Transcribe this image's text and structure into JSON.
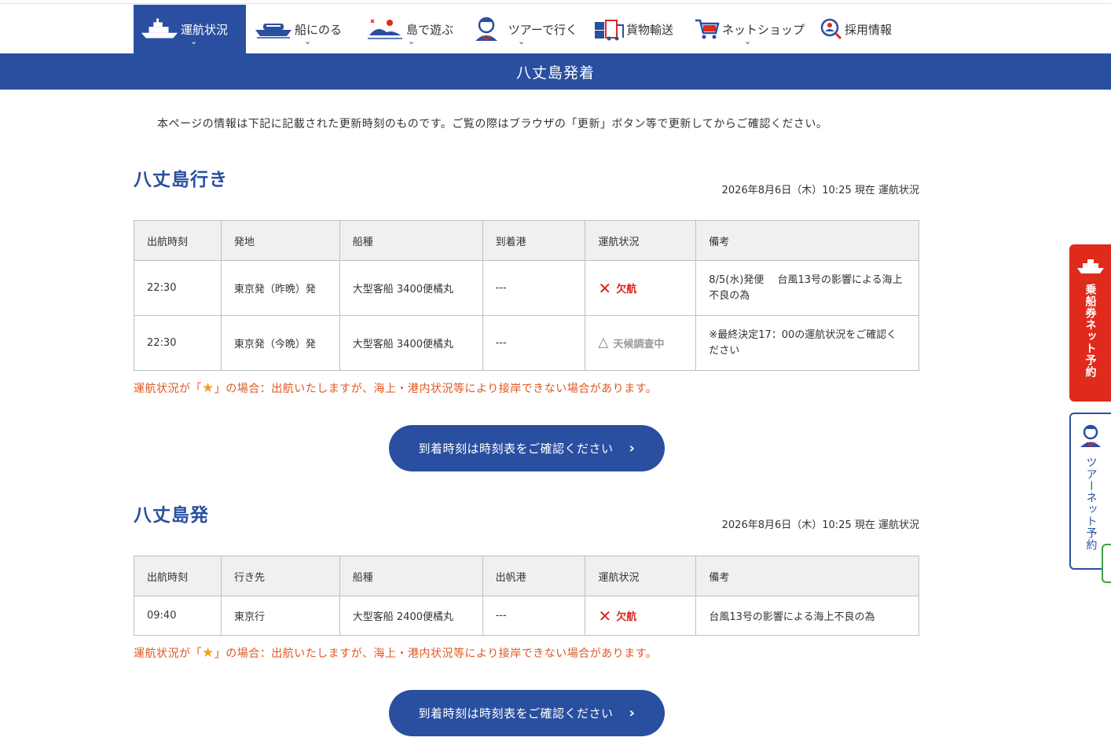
{
  "nav": {
    "items": [
      {
        "label": "運航状況",
        "icon": "ship-icon",
        "active": true
      },
      {
        "label": "船にのる",
        "icon": "ferry-icon"
      },
      {
        "label": "島で遊ぶ",
        "icon": "island-icon"
      },
      {
        "label": "ツアーで行く",
        "icon": "guide-icon"
      },
      {
        "label": "貨物輸送",
        "icon": "cargo-icon"
      },
      {
        "label": "ネットショップ",
        "icon": "cart-icon"
      },
      {
        "label": "採用情報",
        "icon": "recruit-icon"
      }
    ]
  },
  "banner": {
    "title": "八丈島発着"
  },
  "notice": "本ページの情報は下記に記載された更新時刻のものです。ご覧の際はブラウザの「更新」ボタン等で更新してからご確認ください。",
  "sections": [
    {
      "title": "八丈島行き",
      "asof": "2026年8月6日（木）10:25 現在 運航状況",
      "headers": [
        "出航時刻",
        "発地",
        "船種",
        "到着港",
        "運航状況",
        "備考"
      ],
      "rows": [
        {
          "time": "22:30",
          "place": "東京発（昨晩）発",
          "ship": "大型客船 3400便橘丸",
          "port": "---",
          "status": "欠航",
          "status_type": "cancel",
          "remarks": "8/5(水)発便　 台風13号の影響による海上不良の為"
        },
        {
          "time": "22:30",
          "place": "東京発（今晩）発",
          "ship": "大型客船 3400便橘丸",
          "port": "---",
          "status": "天候調査中",
          "status_type": "check",
          "remarks": "※最終決定17：00の運航状況をご確認ください"
        }
      ],
      "note_pre": "運航状況が「",
      "note_star": "★",
      "note_post": "」の場合：出航いたしますが、海上・港内状況等により接岸できない場合があります。",
      "button": "到着時刻は時刻表をご確認ください"
    },
    {
      "title": "八丈島発",
      "asof": "2026年8月6日（木）10:25 現在 運航状況",
      "headers": [
        "出航時刻",
        "行き先",
        "船種",
        "出帆港",
        "運航状況",
        "備考"
      ],
      "rows": [
        {
          "time": "09:40",
          "place": "東京行",
          "ship": "大型客船 2400便橘丸",
          "port": "---",
          "status": "欠航",
          "status_type": "cancel",
          "remarks": "台風13号の影響による海上不良の為"
        }
      ],
      "note_pre": "運航状況が「",
      "note_star": "★",
      "note_post": "」の場合：出航いたしますが、海上・港内状況等により接岸できない場合があります。",
      "button": "到着時刻は時刻表をご確認ください"
    }
  ],
  "side": {
    "ticket": "乗船券ネット予約",
    "tour": "ツアーネット予約"
  },
  "colors": {
    "brand": "#2a4fa0",
    "cancel": "#e02020",
    "note": "#e0571f",
    "side_ticket": "#e02a1c"
  }
}
